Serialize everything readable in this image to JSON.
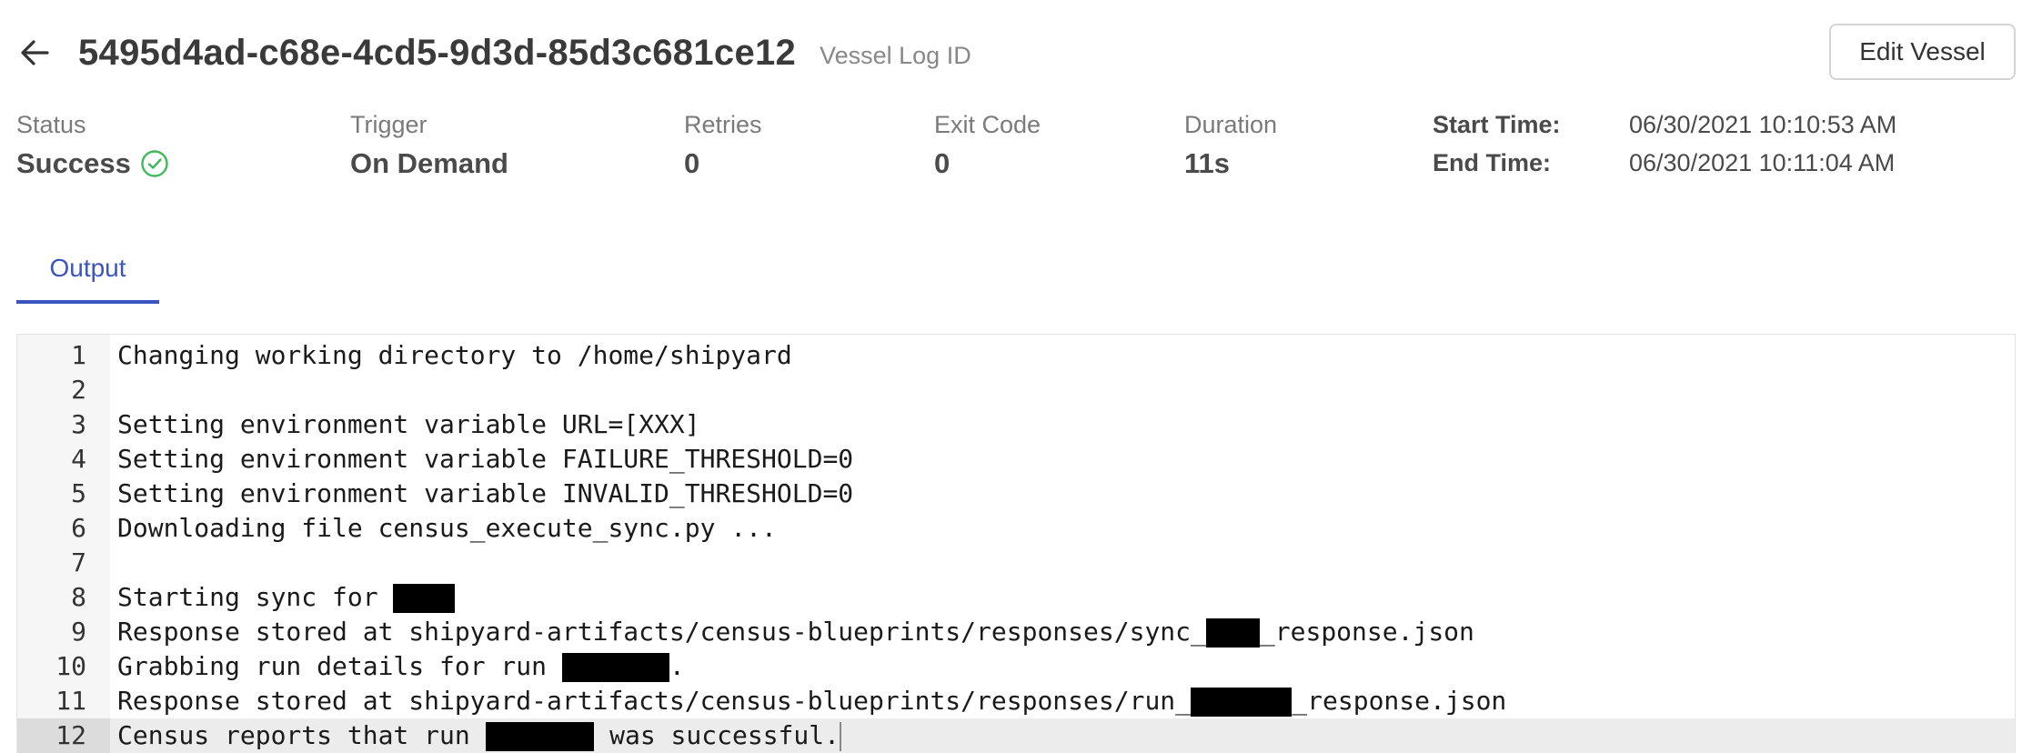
{
  "header": {
    "log_id": "5495d4ad-c68e-4cd5-9d3d-85d3c681ce12",
    "log_id_label": "Vessel Log ID",
    "back_icon": "arrow-left-icon",
    "edit_button": "Edit Vessel"
  },
  "stats": {
    "status": {
      "label": "Status",
      "value": "Success",
      "icon": "check-circle-icon",
      "icon_color": "#3fb95b"
    },
    "trigger": {
      "label": "Trigger",
      "value": "On Demand"
    },
    "retries": {
      "label": "Retries",
      "value": "0"
    },
    "exit_code": {
      "label": "Exit Code",
      "value": "0"
    },
    "duration": {
      "label": "Duration",
      "value": "11s"
    }
  },
  "times": {
    "start_label": "Start Time:",
    "start_value": "06/30/2021 10:10:53 AM",
    "end_label": "End Time:",
    "end_value": "06/30/2021 10:11:04 AM"
  },
  "tabs": {
    "output": "Output",
    "accent_color": "#3b54c0"
  },
  "console": {
    "active_line": 12,
    "lines": [
      {
        "n": "1",
        "parts": [
          {
            "t": "Changing working directory to /home/shipyard"
          }
        ]
      },
      {
        "n": "2",
        "parts": []
      },
      {
        "n": "3",
        "parts": [
          {
            "t": "Setting environment variable URL=[XXX]"
          }
        ]
      },
      {
        "n": "4",
        "parts": [
          {
            "t": "Setting environment variable FAILURE_THRESHOLD=0"
          }
        ]
      },
      {
        "n": "5",
        "parts": [
          {
            "t": "Setting environment variable INVALID_THRESHOLD=0"
          }
        ]
      },
      {
        "n": "6",
        "parts": [
          {
            "t": "Downloading file census_execute_sync.py ..."
          }
        ]
      },
      {
        "n": "7",
        "parts": []
      },
      {
        "n": "8",
        "parts": [
          {
            "t": "Starting sync for "
          },
          {
            "redact": 4
          }
        ]
      },
      {
        "n": "9",
        "parts": [
          {
            "t": "Response stored at shipyard-artifacts/census-blueprints/responses/sync_"
          },
          {
            "redact": 3.5
          },
          {
            "t": "_response.json"
          }
        ]
      },
      {
        "n": "10",
        "parts": [
          {
            "t": "Grabbing run details for run "
          },
          {
            "redact": 7
          },
          {
            "t": "."
          }
        ]
      },
      {
        "n": "11",
        "parts": [
          {
            "t": "Response stored at shipyard-artifacts/census-blueprints/responses/run_"
          },
          {
            "redact": 6.6
          },
          {
            "t": "_response.json"
          }
        ]
      },
      {
        "n": "12",
        "parts": [
          {
            "t": "Census reports that run "
          },
          {
            "redact": 7.1
          },
          {
            "t": " was successful."
          }
        ]
      }
    ]
  }
}
